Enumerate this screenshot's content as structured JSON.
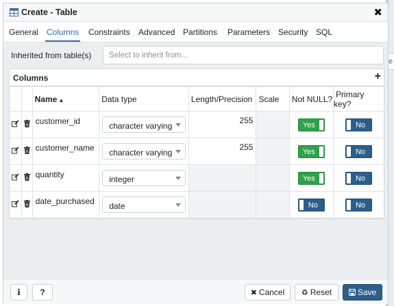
{
  "dialog": {
    "title": "Create - Table",
    "close_glyph": "✖"
  },
  "tabs": [
    {
      "label": "General"
    },
    {
      "label": "Columns",
      "active": true
    },
    {
      "label": "Constraints"
    },
    {
      "label": "Advanced"
    },
    {
      "label": "Partitions"
    },
    {
      "label": "Parameters"
    },
    {
      "label": "Security"
    },
    {
      "label": "SQL"
    }
  ],
  "inherit": {
    "label": "Inherited from table(s)",
    "placeholder": "Select to inherit from..."
  },
  "columns_panel": {
    "title": "Columns",
    "add_glyph": "+",
    "headers": {
      "name": "Name",
      "sort_glyph": "▲",
      "data_type": "Data type",
      "length": "Length/Precision",
      "scale": "Scale",
      "not_null": "Not NULL?",
      "primary_key": "Primary key?"
    },
    "rows": [
      {
        "name": "customer_id",
        "data_type": "character varying",
        "length": "255",
        "not_null": "Yes",
        "primary_key": "No"
      },
      {
        "name": "customer_name",
        "data_type": "character varying",
        "length": "255",
        "not_null": "Yes",
        "primary_key": "No"
      },
      {
        "name": "quantity",
        "data_type": "integer",
        "length": "",
        "not_null": "Yes",
        "primary_key": "No"
      },
      {
        "name": "date_purchased",
        "data_type": "date",
        "length": "",
        "not_null": "No",
        "primary_key": "No"
      }
    ]
  },
  "footer": {
    "info_label": "i",
    "help_label": "?",
    "cancel_label": "Cancel",
    "reset_label": "Reset",
    "save_label": "Save"
  },
  "colors": {
    "accent": "#2d6ca2",
    "toggle_yes": "#2fa14a",
    "toggle_no": "#2b5f8a",
    "save_bg": "#2b5f8a"
  },
  "background_tab_glyph": "e"
}
